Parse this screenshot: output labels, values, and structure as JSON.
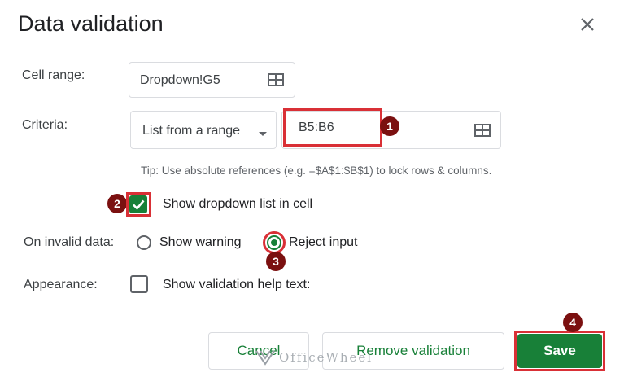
{
  "dialog": {
    "title": "Data validation",
    "close_icon": "close-icon"
  },
  "cell_range": {
    "label": "Cell range:",
    "value": "Dropdown!G5"
  },
  "criteria": {
    "label": "Criteria:",
    "type_selected": "List from a range",
    "range_value": "B5:B6",
    "tip": "Tip: Use absolute references (e.g. =$A$1:$B$1) to lock rows & columns."
  },
  "show_dropdown": {
    "label": "Show dropdown list in cell",
    "checked": true
  },
  "on_invalid": {
    "label": "On invalid data:",
    "options": [
      "Show warning",
      "Reject input"
    ],
    "selected": "Reject input"
  },
  "appearance": {
    "label": "Appearance:",
    "checkbox_label": "Show validation help text:",
    "checked": false
  },
  "buttons": {
    "cancel": "Cancel",
    "remove": "Remove validation",
    "save": "Save"
  },
  "badges": [
    "1",
    "2",
    "3",
    "4"
  ],
  "watermark": "OfficeWheel",
  "colors": {
    "accent_green": "#188038",
    "highlight_red": "#d93036",
    "badge_maroon": "#7b1010"
  }
}
